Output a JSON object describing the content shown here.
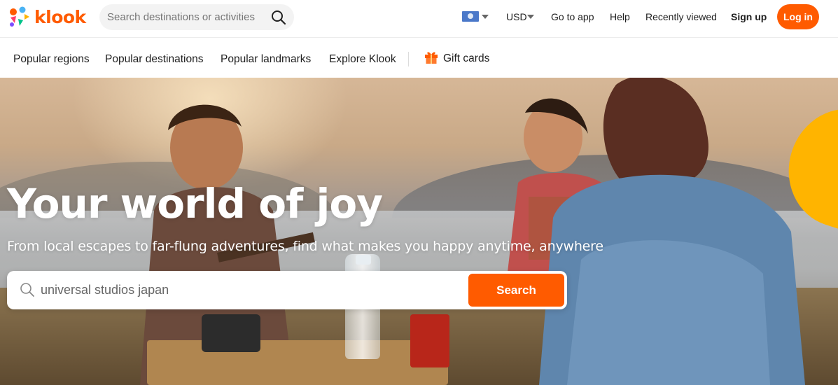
{
  "brand": {
    "name": "klook",
    "accent_color": "#ff5b00",
    "logo_icon": "klook-logo-icon"
  },
  "header": {
    "search_placeholder": "Search destinations or activities",
    "search_icon": "search-icon",
    "language_icon": "flag-icon",
    "currency": "USD",
    "go_to_app": "Go to app",
    "help": "Help",
    "recently_viewed": "Recently viewed",
    "sign_up": "Sign up",
    "log_in": "Log in"
  },
  "subnav": {
    "items": [
      {
        "label": "Popular regions"
      },
      {
        "label": "Popular destinations"
      },
      {
        "label": "Popular landmarks"
      },
      {
        "label": "Explore Klook"
      }
    ],
    "gift_cards": {
      "label": "Gift cards",
      "icon": "gift-icon"
    }
  },
  "hero": {
    "title": "Your world of joy",
    "subtitle": "From local escapes to far-flung adventures, find what makes you happy anytime, anywhere",
    "search_value": "universal studios japan",
    "search_button": "Search",
    "decor_color": "#ffb400"
  }
}
